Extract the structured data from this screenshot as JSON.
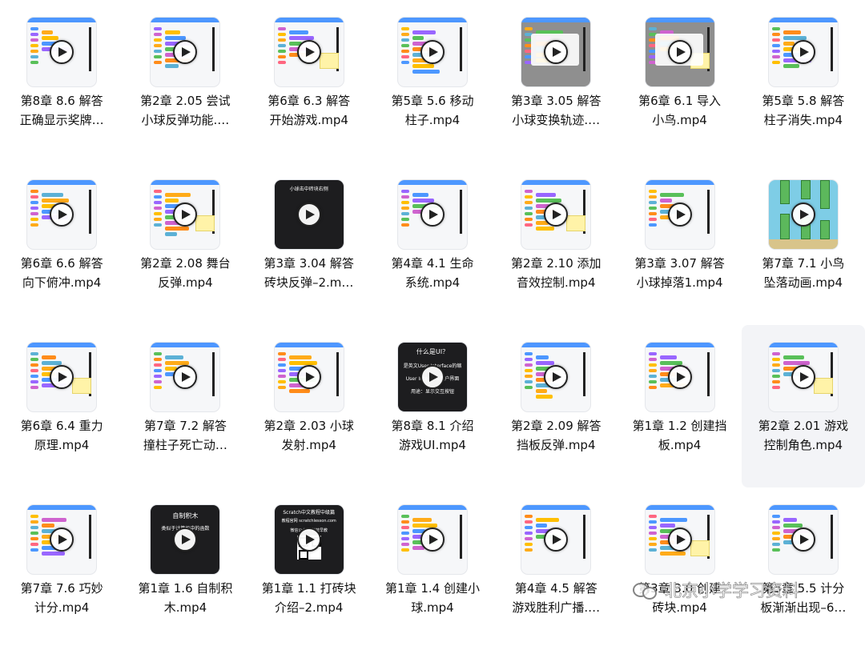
{
  "videos": [
    {
      "line1": "第8章 8.6 解答",
      "line2": "正确显示奖牌…",
      "thumb": "light"
    },
    {
      "line1": "第2章 2.05 尝试",
      "line2": "小球反弹功能.…",
      "thumb": "light"
    },
    {
      "line1": "第6章 6.3 解答",
      "line2": "开始游戏.mp4",
      "thumb": "light"
    },
    {
      "line1": "第5章 5.6 移动",
      "line2": "柱子.mp4",
      "thumb": "light"
    },
    {
      "line1": "第3章 3.05 解答",
      "line2": "小球变换轨迹.…",
      "thumb": "gray"
    },
    {
      "line1": "第6章 6.1 导入",
      "line2": "小鸟.mp4",
      "thumb": "gray"
    },
    {
      "line1": "第5章 5.8 解答",
      "line2": "柱子消失.mp4",
      "thumb": "light"
    },
    {
      "line1": "第6章 6.6 解答",
      "line2": "向下俯冲.mp4",
      "thumb": "light"
    },
    {
      "line1": "第2章 2.08 舞台",
      "line2": "反弹.mp4",
      "thumb": "light"
    },
    {
      "line1": "第3章 3.04 解答",
      "line2": "砖块反弹–2.m…",
      "thumb": "dark"
    },
    {
      "line1": "第4章 4.1 生命",
      "line2": "系统.mp4",
      "thumb": "light"
    },
    {
      "line1": "第2章 2.10 添加",
      "line2": "音效控制.mp4",
      "thumb": "light"
    },
    {
      "line1": "第3章 3.07 解答",
      "line2": "小球掉落1.mp4",
      "thumb": "light"
    },
    {
      "line1": "第7章 7.1 小鸟",
      "line2": "坠落动画.mp4",
      "thumb": "game"
    },
    {
      "line1": "第6章 6.4 重力",
      "line2": "原理.mp4",
      "thumb": "light"
    },
    {
      "line1": "第7章 7.2 解答",
      "line2": "撞柱子死亡动…",
      "thumb": "light"
    },
    {
      "line1": "第2章 2.03 小球",
      "line2": "发射.mp4",
      "thumb": "light"
    },
    {
      "line1": "第8章 8.1 介绍",
      "line2": "游戏UI.mp4",
      "thumb": "dark"
    },
    {
      "line1": "第2章 2.09 解答",
      "line2": "挡板反弹.mp4",
      "thumb": "light"
    },
    {
      "line1": "第1章 1.2 创建挡",
      "line2": "板.mp4",
      "thumb": "light"
    },
    {
      "line1": "第2章 2.01 游戏",
      "line2": "控制角色.mp4",
      "thumb": "light",
      "highlighted": true
    },
    {
      "line1": "第7章 7.6 巧妙",
      "line2": "计分.mp4",
      "thumb": "light"
    },
    {
      "line1": "第1章 1.6 自制积",
      "line2": "木.mp4",
      "thumb": "dark"
    },
    {
      "line1": "第1章 1.1 打砖块",
      "line2": "介绍–2.mp4",
      "thumb": "dark"
    },
    {
      "line1": "第1章 1.4 创建小",
      "line2": "球.mp4",
      "thumb": "light"
    },
    {
      "line1": "第4章 4.5 解答",
      "line2": "游戏胜利广播.…",
      "thumb": "light"
    },
    {
      "line1": "第3章 3.0 创建",
      "line2": "砖块.mp4",
      "thumb": "light"
    },
    {
      "line1": "第5章 5.5 计分",
      "line2": "板渐渐出现–6…",
      "thumb": "light"
    }
  ],
  "thumb_texts": {
    "t9": "小球击中砖块右侧",
    "t17a": "什么是UI？",
    "t17b": "是英文User Interface的缩",
    "t17c": "User Interface用户界面",
    "t17d": "用途：显示交互按钮",
    "t22a": "自制积木",
    "t22b": "类似于计算机中的函数",
    "t23a": "Scratch中文教程中级篇",
    "t23b": "教程官网 scratchlesson.com",
    "t23c": "微信公众号  科技早教"
  },
  "watermark": "北京小学学习资料",
  "colors": {
    "accent": "#4d97ff",
    "note": "#fff3a8",
    "highlight": "#f3f4f7"
  }
}
